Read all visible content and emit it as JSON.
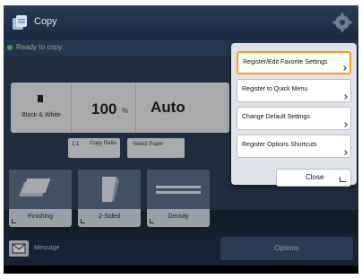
{
  "header": {
    "title": "Copy",
    "app_icon": "copy-icon",
    "settings_icon": "gear-icon"
  },
  "status": {
    "text": "Ready to copy.",
    "color": "#4ee36a"
  },
  "copy_settings": {
    "color_mode": "Black & White",
    "ratio_value": "100",
    "ratio_unit": "%",
    "paper": "Auto",
    "ratio_button_prefix": "1:1",
    "ratio_button_label": "Copy Ratio",
    "paper_button_label": "Select Paper"
  },
  "functions": [
    {
      "label": "Finishing",
      "icon": "finishing-icon"
    },
    {
      "label": "2-Sided",
      "icon": "two-sided-icon"
    },
    {
      "label": "Density",
      "icon": "density-icon"
    }
  ],
  "bottom": {
    "message_label": "Message",
    "options_label": "Options"
  },
  "popup": {
    "items": [
      {
        "label": "Register/Edit Favorite Settings"
      },
      {
        "label": "Register to Quick Menu"
      },
      {
        "label": "Change Default Settings"
      },
      {
        "label": "Register Options Shortcuts"
      }
    ],
    "close_label": "Close",
    "highlight_color": "#f6a21b"
  }
}
